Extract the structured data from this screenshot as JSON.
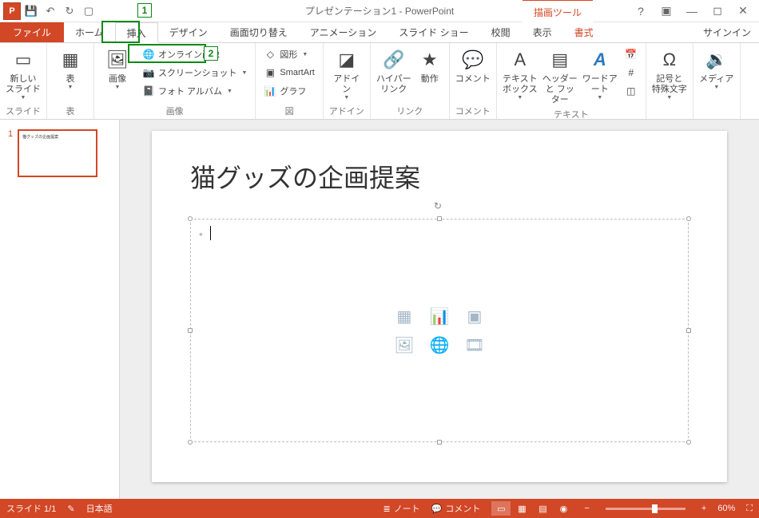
{
  "title": "プレゼンテーション1 - PowerPoint",
  "context_tool_label": "描画ツール",
  "signin": "サインイン",
  "tabs": {
    "file": "ファイル",
    "home": "ホーム",
    "insert": "挿入",
    "design": "デザイン",
    "transitions": "画面切り替え",
    "animations": "アニメーション",
    "slideshow": "スライド ショー",
    "review": "校閲",
    "view": "表示",
    "format": "書式"
  },
  "ribbon": {
    "groups": {
      "slides": "スライド",
      "tables": "表",
      "images": "画像",
      "illustrations": "図",
      "addins": "アドイン",
      "links": "リンク",
      "comments": "コメント",
      "text": "テキスト",
      "symbols": "記号と\n特殊文字",
      "media": "メディア"
    },
    "new_slide": "新しい\nスライド",
    "table": "表",
    "pictures": "画像",
    "online_pictures": "オンライン画像",
    "screenshot": "スクリーンショット",
    "photo_album": "フォト アルバム",
    "shapes": "図形",
    "smartart": "SmartArt",
    "chart": "グラフ",
    "addins": "アドイ\nン",
    "hyperlink": "ハイパーリンク",
    "action": "動作",
    "comment": "コメント",
    "textbox": "テキスト\nボックス",
    "header_footer": "ヘッダーと\nフッター",
    "wordart": "ワードアート",
    "symbol": "記号と\n特殊文字",
    "media": "メディア"
  },
  "callouts": {
    "tab": "1",
    "button": "2"
  },
  "slides": {
    "current": 1,
    "items": [
      {
        "title": "猫グッズの企画提案"
      }
    ]
  },
  "status": {
    "slide_indicator": "スライド 1/1",
    "language": "日本語",
    "notes": "ノート",
    "comments": "コメント",
    "zoom": "60%"
  }
}
